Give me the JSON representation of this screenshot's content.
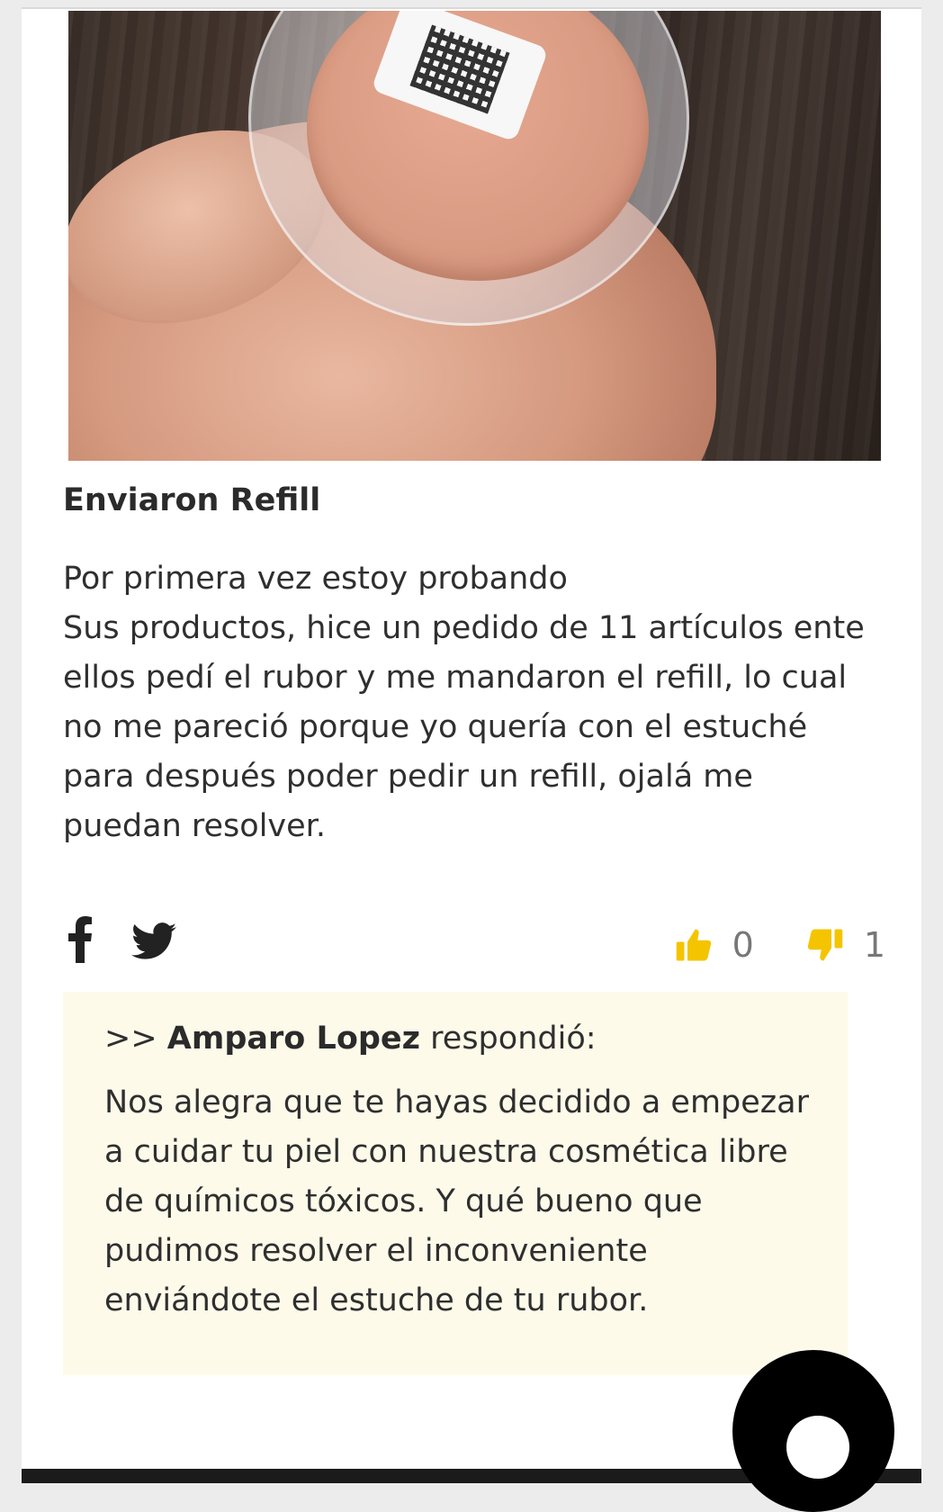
{
  "review": {
    "title": "Enviaron Refill",
    "body_lines": [
      "Por primera vez estoy probando",
      "Sus productos, hice un pedido de 11 artículos ente",
      "ellos pedí el rubor y me mandaron el refill, lo cual",
      "no me pareció porque yo quería con el estuché",
      "para después poder pedir un refill, ojalá me",
      "puedan resolver."
    ]
  },
  "share": {
    "facebook_icon": "facebook-icon",
    "twitter_icon": "twitter-icon"
  },
  "votes": {
    "up_count": "0",
    "down_count": "1",
    "accent_color": "#f5c400"
  },
  "reply": {
    "prefix": ">>",
    "author": "Amparo Lopez",
    "verb": "respondió:",
    "body_lines": [
      "Nos alegra que te hayas decidido a empezar",
      "a cuidar tu piel con nuestra cosmética libre",
      "de químicos tóxicos. Y qué bueno que",
      "pudimos resolver el inconveniente",
      "enviándote el estuche de tu rubor."
    ],
    "background": "#fdfaea"
  }
}
